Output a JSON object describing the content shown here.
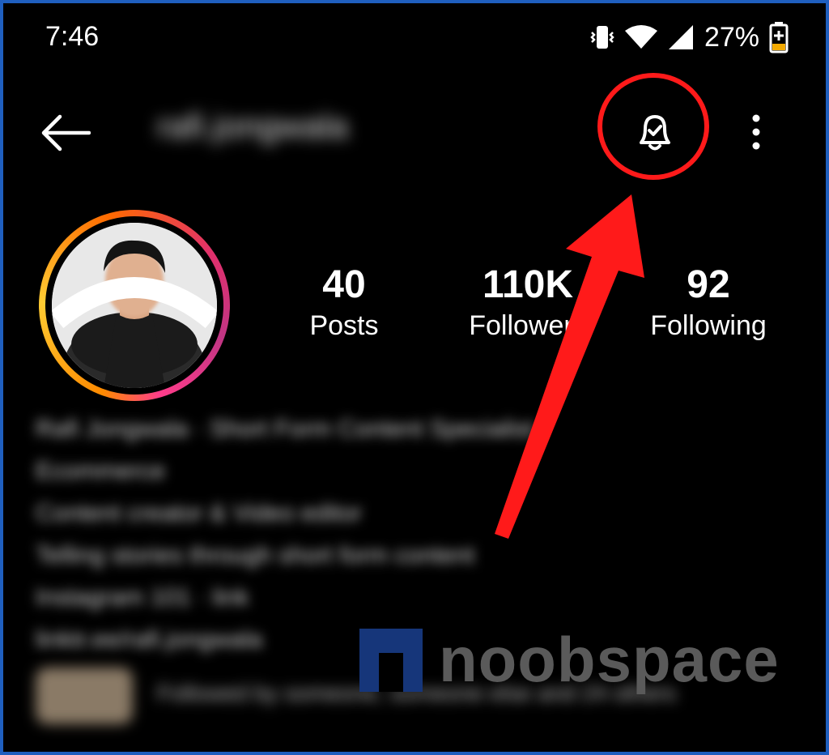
{
  "status_bar": {
    "time": "7:46",
    "battery": "27%"
  },
  "header": {
    "username": "rafi.jongwala",
    "back_icon": "arrow-left-icon",
    "bell_icon": "bell-check-icon",
    "more_icon": "more-vertical-icon"
  },
  "profile": {
    "stats": [
      {
        "value": "40",
        "label": "Posts"
      },
      {
        "value": "110K",
        "label": "Followers"
      },
      {
        "value": "92",
        "label": "Following"
      }
    ]
  },
  "bio": {
    "lines": [
      "Rafi Jongwala · Short Form Content Specialist",
      "Ecommerce",
      "Content creator & Video editor",
      "Telling stories through short form content",
      "Instagram 101 · link",
      "linktr.ee/rafi.jongwala"
    ],
    "highlight_text": "Followed by someone, someone else and 24 others"
  },
  "watermark": {
    "text": "noobspace"
  },
  "colors": {
    "annotation": "#ff1a1a",
    "border": "#1f5fbf",
    "background": "#000000"
  }
}
